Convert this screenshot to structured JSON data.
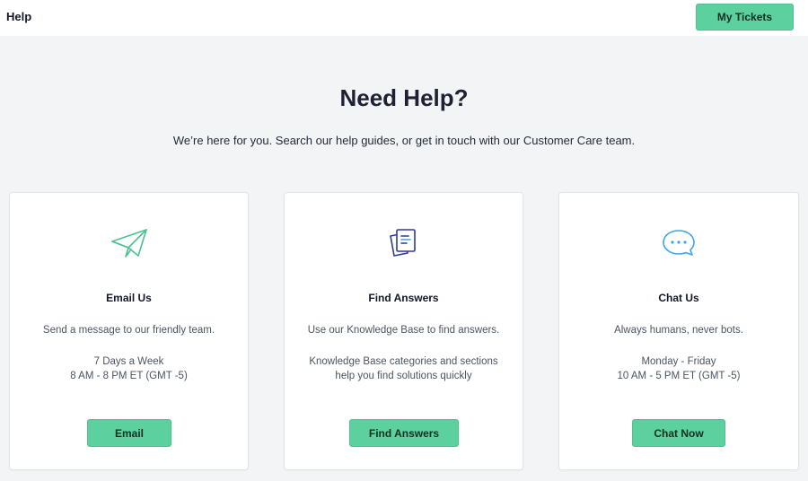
{
  "header": {
    "brand": "Help",
    "my_tickets_label": "My Tickets"
  },
  "hero": {
    "title": "Need Help?",
    "subtitle": "We’re here for you. Search our help guides, or get in touch with our Customer Care team."
  },
  "cards": [
    {
      "icon": "paper-plane-icon",
      "title": "Email Us",
      "description": "Send a message to our friendly team.",
      "detail_lines": [
        "7 Days a Week",
        "8 AM - 8 PM ET (GMT -5)"
      ],
      "button_label": "Email"
    },
    {
      "icon": "documents-icon",
      "title": "Find Answers",
      "description": "Use our Knowledge Base to find answers.",
      "detail_lines": [
        "Knowledge Base categories and sections",
        "help you find solutions quickly"
      ],
      "button_label": "Find Answers"
    },
    {
      "icon": "chat-bubble-icon",
      "title": "Chat Us",
      "description": "Always humans, never bots.",
      "detail_lines": [
        "Monday - Friday",
        "10 AM - 5 PM ET (GMT -5)"
      ],
      "button_label": "Chat Now"
    }
  ],
  "colors": {
    "accent": "#5cd09e",
    "background": "#f3f4f6",
    "heading": "#1e2133",
    "icon_green": "#4cc28f",
    "icon_navy": "#2f3a8f",
    "icon_blue": "#3ea6e8"
  }
}
